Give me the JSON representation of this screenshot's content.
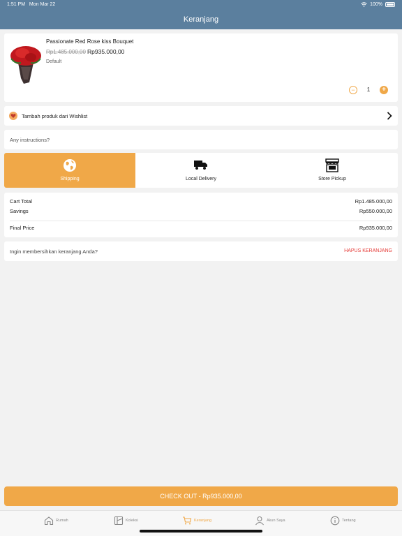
{
  "status": {
    "time": "1:51 PM",
    "date": "Mon Mar 22",
    "battery": "100%"
  },
  "header": {
    "title": "Keranjang"
  },
  "cart_item": {
    "name": "Passionate Red Rose kiss Bouquet",
    "original_price": "Rp1.485.000,00",
    "price": "Rp935.000,00",
    "variant": "Default",
    "quantity": "1",
    "minus": "−",
    "plus": "+"
  },
  "wishlist": {
    "label": "Tambah produk dari Wishlist"
  },
  "instructions": {
    "placeholder": "Any instructions?"
  },
  "delivery_options": [
    {
      "label": "Shipping",
      "icon": "globe-icon",
      "active": true
    },
    {
      "label": "Local Delivery",
      "icon": "truck-icon",
      "active": false
    },
    {
      "label": "Store Pickup",
      "icon": "store-icon",
      "active": false
    }
  ],
  "totals": {
    "cart_total_label": "Cart Total",
    "cart_total_value": "Rp1.485.000,00",
    "savings_label": "Savings",
    "savings_value": "Rp550.000,00",
    "final_label": "Final Price",
    "final_value": "Rp935.000,00"
  },
  "clear_cart": {
    "question": "Ingin membersihkan keranjang Anda?",
    "action": "HAPUS KERANJANG"
  },
  "checkout": {
    "label": "CHECK OUT - Rp935.000,00"
  },
  "tabs": [
    {
      "label": "Rumah",
      "icon": "home-icon"
    },
    {
      "label": "Koleksi",
      "icon": "collection-icon"
    },
    {
      "label": "Keranjang",
      "icon": "cart-icon"
    },
    {
      "label": "Akun Saya",
      "icon": "user-icon"
    },
    {
      "label": "Tentang",
      "icon": "info-icon"
    }
  ],
  "colors": {
    "header": "#5b7f9e",
    "accent": "#f0a848",
    "danger": "#e53935"
  }
}
